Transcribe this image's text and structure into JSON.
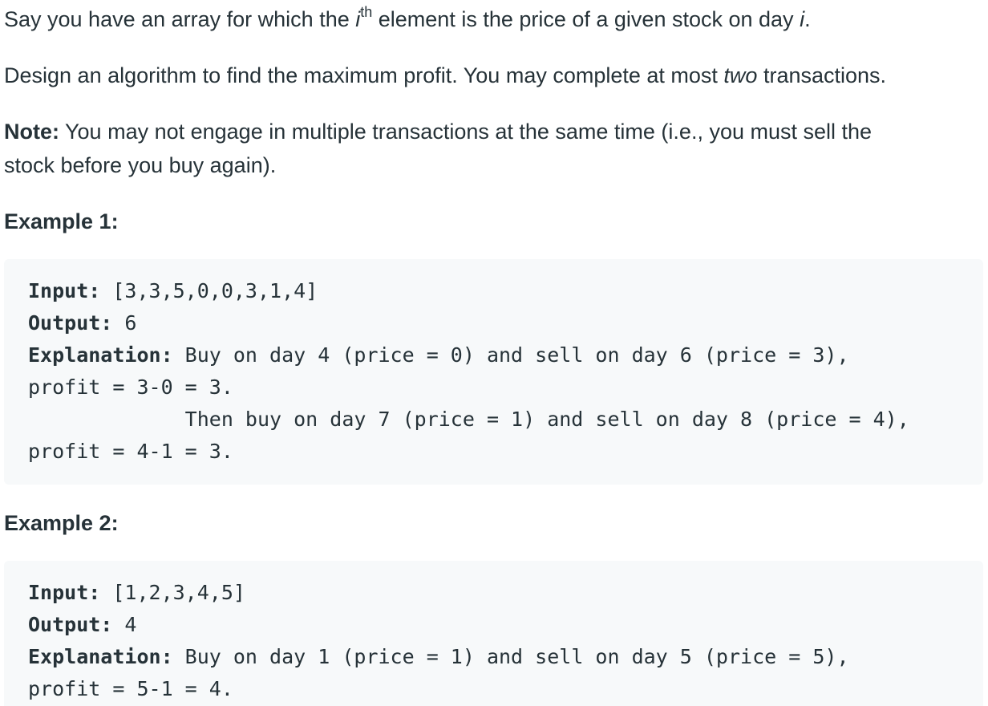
{
  "problem": {
    "intro": {
      "part1": "Say you have an array for which the ",
      "i_var": "i",
      "th_sup": "th",
      "part2": " element is the price of a given stock on day ",
      "i_var2": "i",
      "part3": "."
    },
    "task": {
      "part1": "Design an algorithm to find the maximum profit. You may complete at most ",
      "emph": "two",
      "part2": " transactions."
    },
    "note": {
      "label": "Note:",
      "line1": " You may not engage in multiple transactions at the same time (i.e., you must sell the",
      "line2": "stock before you buy again)."
    }
  },
  "examples": [
    {
      "heading": "Example 1:",
      "input_label": "Input:",
      "input_value": " [3,3,5,0,0,3,1,4]",
      "output_label": "Output:",
      "output_value": " 6",
      "explanation_label": "Explanation:",
      "explanation_lines": [
        " Buy on day 4 (price = 0) and sell on day 6 (price = 3),",
        "profit = 3-0 = 3.",
        "             Then buy on day 7 (price = 1) and sell on day 8 (price = 4),",
        "profit = 4-1 = 3."
      ]
    },
    {
      "heading": "Example 2:",
      "input_label": "Input:",
      "input_value": " [1,2,3,4,5]",
      "output_label": "Output:",
      "output_value": " 4",
      "explanation_label": "Explanation:",
      "explanation_lines": [
        " Buy on day 1 (price = 1) and sell on day 5 (price = 5),",
        "profit = 5-1 = 4."
      ]
    }
  ]
}
